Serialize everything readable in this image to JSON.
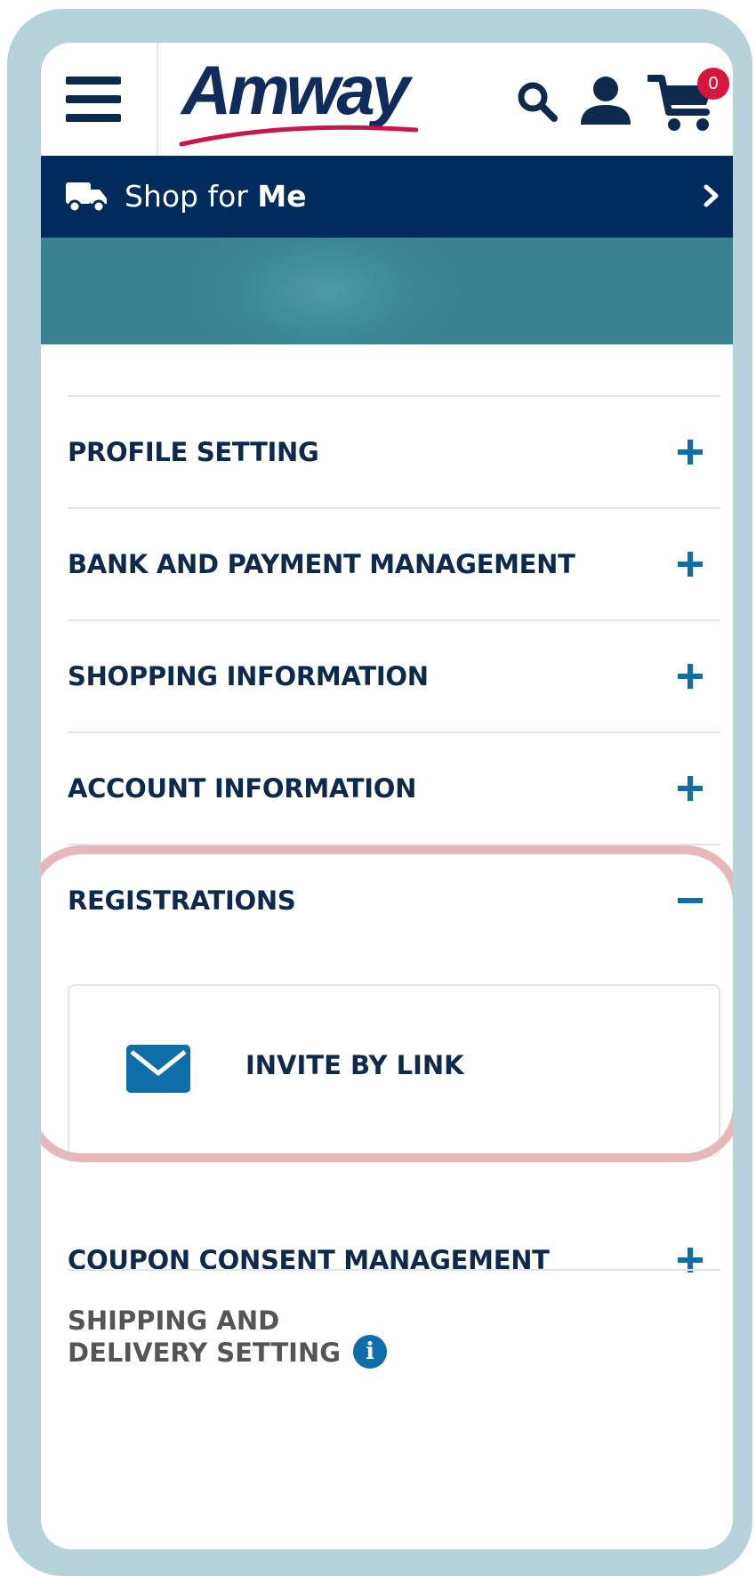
{
  "header": {
    "logo_text": "Amway",
    "cart_count": "0"
  },
  "shop_bar": {
    "label_prefix": "Shop for",
    "label_bold": "Me"
  },
  "menu": {
    "items": [
      {
        "label": "PROFILE SETTING",
        "state": "+"
      },
      {
        "label": "BANK AND PAYMENT MANAGEMENT",
        "state": "+"
      },
      {
        "label": "SHOPPING INFORMATION",
        "state": "+"
      },
      {
        "label": "ACCOUNT INFORMATION",
        "state": "+"
      },
      {
        "label": "REGISTRATIONS",
        "state": "-"
      },
      {
        "label": "COUPON CONSENT MANAGEMENT",
        "state": "+"
      }
    ],
    "registrations_sub": {
      "invite_label": "INVITE BY LINK"
    },
    "shipping": {
      "line1": "SHIPPING AND",
      "line2": "DELIVERY SETTING",
      "info_glyph": "i"
    }
  },
  "colors": {
    "bezel": "#b5d3d9",
    "navy": "#002b5c",
    "accent_blue": "#0e6ea8",
    "highlight": "#e8b7b9",
    "badge": "#d6163b"
  }
}
